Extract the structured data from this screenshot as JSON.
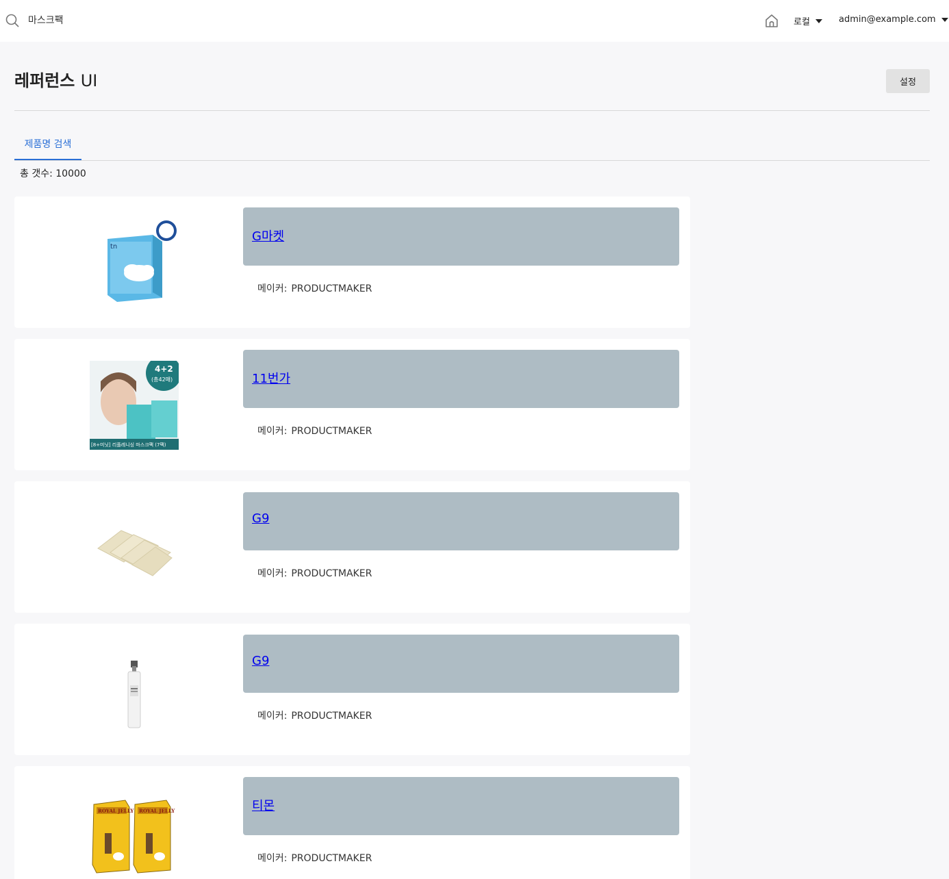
{
  "search": {
    "query": "마스크팩",
    "icon": "search-icon"
  },
  "header": {
    "home_icon": "home-icon",
    "locale": "로컬",
    "account": "admin@example.com"
  },
  "page": {
    "title": "레퍼런스",
    "title_suffix": "UI",
    "settings_label": "설정"
  },
  "tabs": [
    {
      "label": "제품명 검색",
      "active": true
    }
  ],
  "total_label": "총 갯수: 10000",
  "maker_label": "메이커:",
  "results": [
    {
      "title": "G마켓",
      "maker": "PRODUCTMAKER",
      "image": "blue-mask-box"
    },
    {
      "title": "11번가",
      "maker": "PRODUCTMAKER",
      "image": "face-mask-packs",
      "image_badge": "4+2",
      "image_badge_sub": "(총42매)",
      "image_caption": "[8+미닛] 리플레니싱 마스크팩 (7팩)"
    },
    {
      "title": "G9",
      "maker": "PRODUCTMAKER",
      "image": "beige-mask-sheets"
    },
    {
      "title": "G9",
      "maker": "PRODUCTMAKER",
      "image": "spray-bottle"
    },
    {
      "title": "티몬",
      "maker": "PRODUCTMAKER",
      "image": "royal-jelly-masks",
      "image_label": "ROYAL JELLY"
    }
  ]
}
